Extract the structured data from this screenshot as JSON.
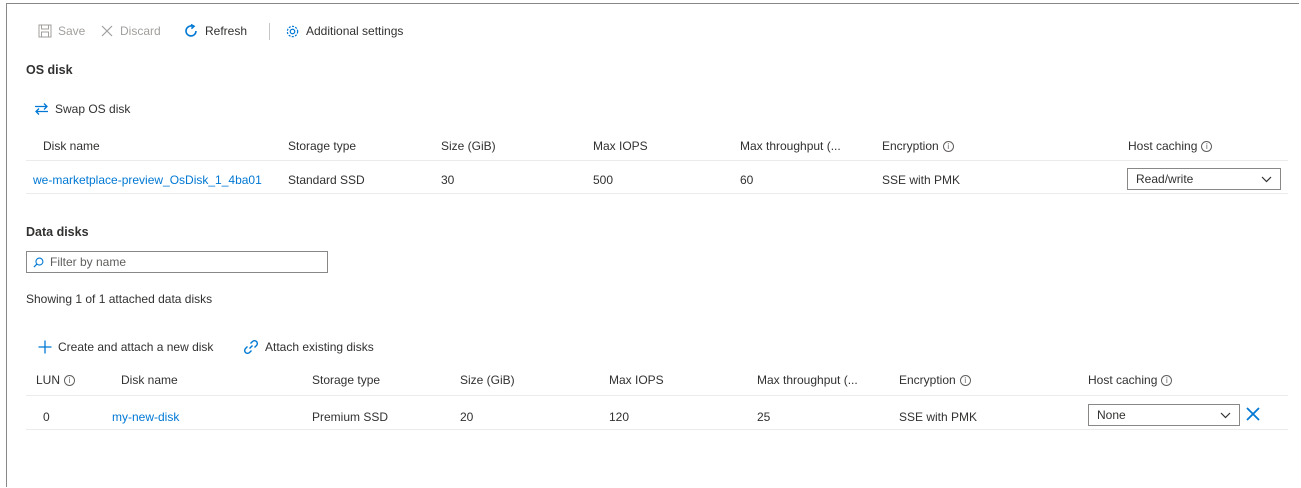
{
  "toolbar": {
    "save": "Save",
    "discard": "Discard",
    "refresh": "Refresh",
    "additional_settings": "Additional settings"
  },
  "os_disk": {
    "title": "OS disk",
    "swap_label": "Swap OS disk",
    "columns": [
      "Disk name",
      "Storage type",
      "Size (GiB)",
      "Max IOPS",
      "Max throughput (...",
      "Encryption",
      "Host caching"
    ],
    "row": {
      "disk_name": "we-marketplace-preview_OsDisk_1_4ba01",
      "storage_type": "Standard SSD",
      "size": "30",
      "max_iops": "500",
      "max_throughput": "60",
      "encryption": "SSE with PMK",
      "host_caching": "Read/write"
    }
  },
  "data_disks": {
    "title": "Data disks",
    "filter_placeholder": "Filter by name",
    "showing_text": "Showing 1 of 1 attached data disks",
    "create_label": "Create and attach a new disk",
    "attach_label": "Attach existing disks",
    "columns": [
      "LUN",
      "Disk name",
      "Storage type",
      "Size (GiB)",
      "Max IOPS",
      "Max throughput (...",
      "Encryption",
      "Host caching"
    ],
    "rows": [
      {
        "lun": "0",
        "disk_name": "my-new-disk",
        "storage_type": "Premium SSD",
        "size": "20",
        "max_iops": "120",
        "max_throughput": "25",
        "encryption": "SSE with PMK",
        "host_caching": "None"
      }
    ]
  },
  "colors": {
    "accent": "#0078d4",
    "muted": "#a19f9d",
    "text": "#323130"
  }
}
